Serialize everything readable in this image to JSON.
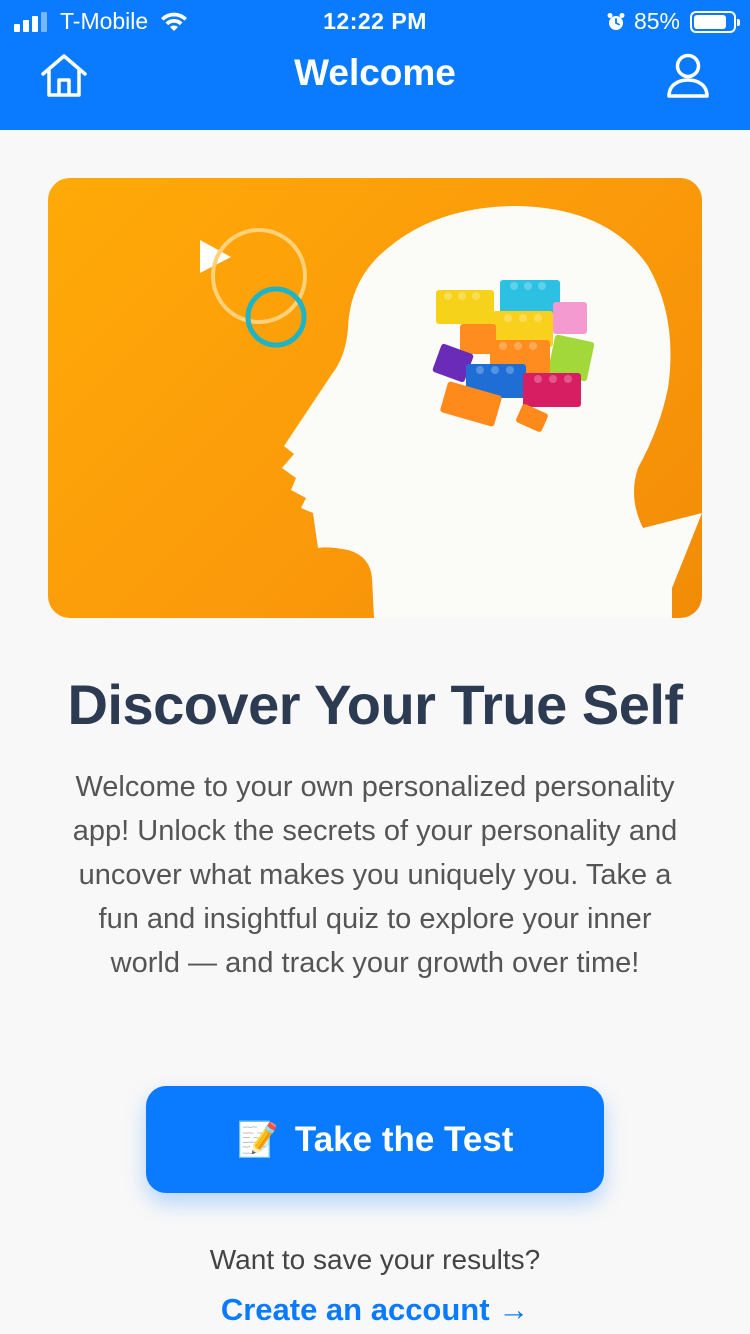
{
  "status_bar": {
    "carrier": "T-Mobile",
    "time": "12:22 PM",
    "battery_percent": "85%",
    "battery_level": 0.85,
    "icons": [
      "signal-icon",
      "wifi-icon",
      "alarm-icon",
      "battery-icon"
    ]
  },
  "header": {
    "title": "Welcome",
    "left_icon": "home-icon",
    "right_icon": "profile-icon",
    "background": "#0a7bfe"
  },
  "hero": {
    "image": "head silhouette with colorful toy bricks on orange background"
  },
  "main": {
    "headline": "Discover Your True Self",
    "description": "Welcome to your own personalized personality app! Unlock the secrets of your personality and uncover what makes you uniquely you. Take a fun and insightful quiz to explore your inner world — and track your growth over time!",
    "cta": {
      "icon": "📝",
      "label": "Take the Test"
    },
    "save_prompt": "Want to save your results?",
    "create_account_link": "Create an account →"
  },
  "colors": {
    "accent": "#0a7bfe",
    "headline": "#2c3a52",
    "hero_background": "#fba00a"
  }
}
